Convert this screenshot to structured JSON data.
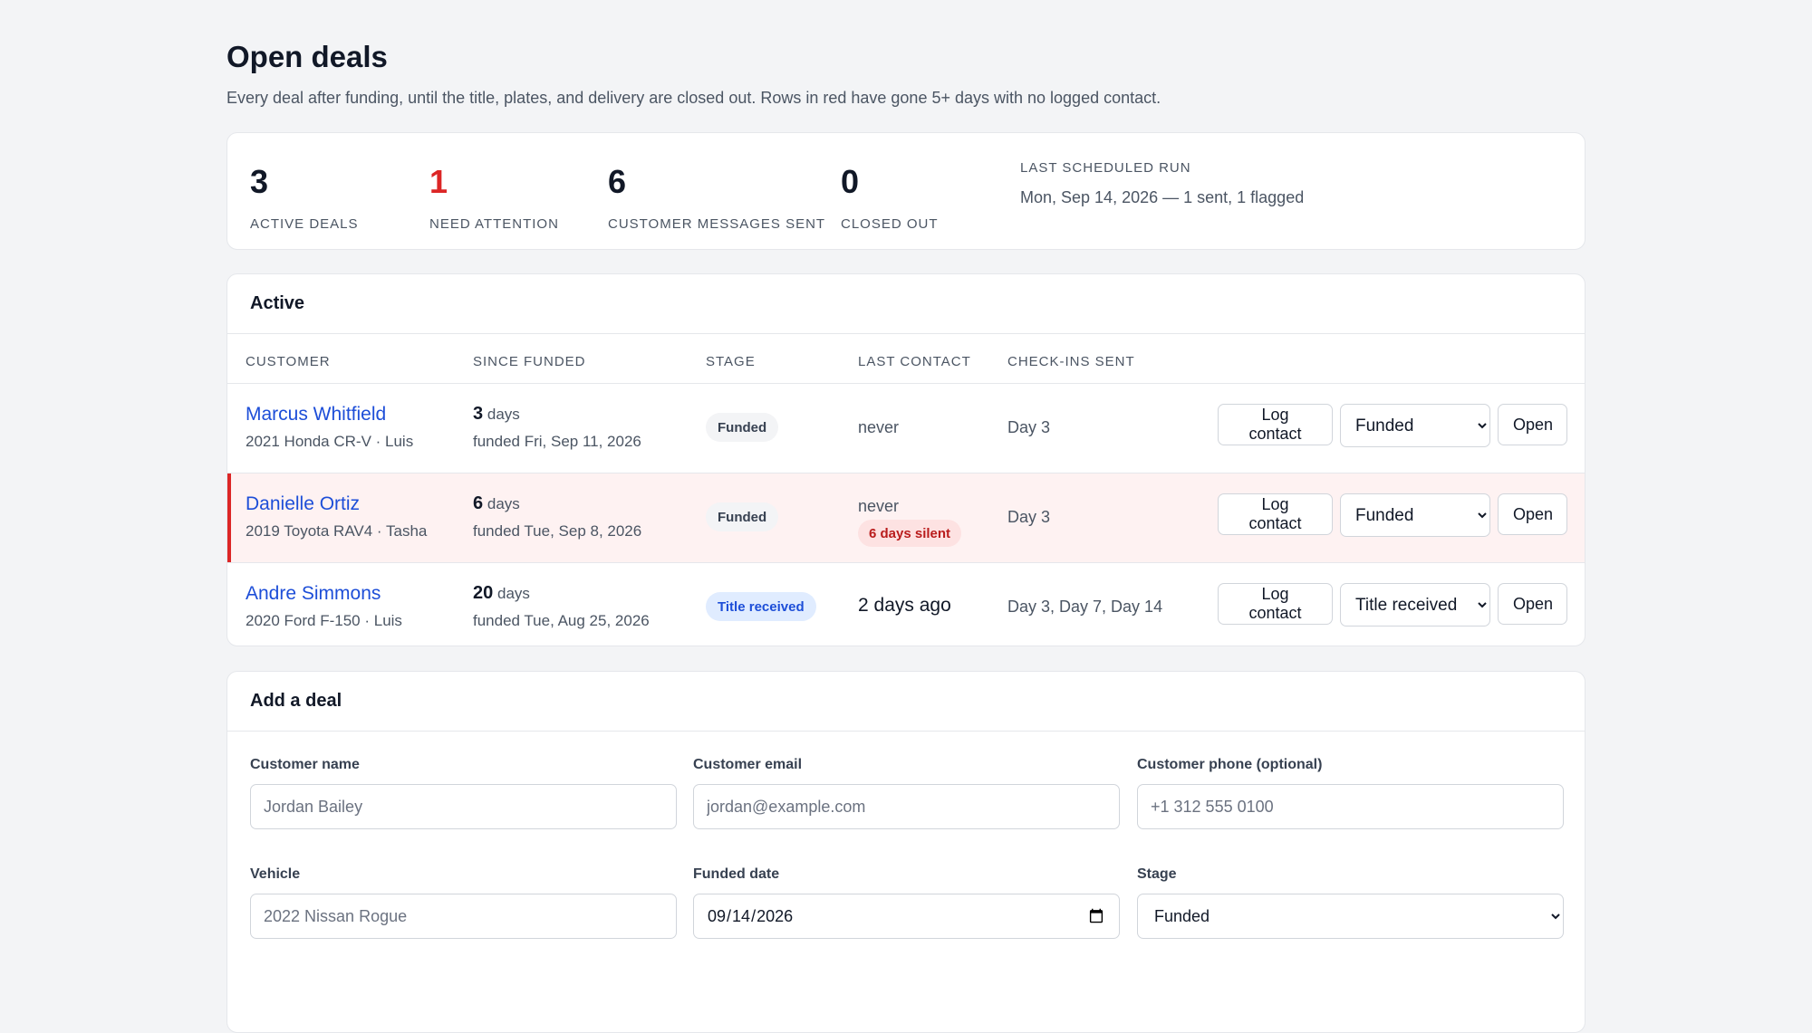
{
  "header": {
    "title": "Open deals",
    "subtitle": "Every deal after funding, until the title, plates, and delivery are closed out. Rows in red have gone 5+ days with no logged contact."
  },
  "stats": [
    {
      "value": "3",
      "label": "ACTIVE DEALS"
    },
    {
      "value": "1",
      "label": "NEED ATTENTION"
    },
    {
      "value": "6",
      "label": "CUSTOMER MESSAGES SENT"
    },
    {
      "value": "0",
      "label": "CLOSED OUT"
    }
  ],
  "last_run": {
    "label": "LAST SCHEDULED RUN",
    "value": "Mon, Sep 14, 2026 — 1 sent, 1 flagged"
  },
  "active": {
    "title": "Active",
    "columns": [
      "CUSTOMER",
      "SINCE FUNDED",
      "STAGE",
      "LAST CONTACT",
      "CHECK-INS SENT"
    ],
    "rows": [
      {
        "name": "Marcus Whitfield",
        "sub": "2021 Honda CR-V · Luis",
        "days": "3",
        "days_unit": "days",
        "funded": "funded Fri, Sep 11, 2026",
        "stage": "Funded",
        "last_contact": "never",
        "silent": "",
        "checkins": "Day 3",
        "log_label": "Log contact",
        "select_value": "Funded",
        "open_label": "Open"
      },
      {
        "name": "Danielle Ortiz",
        "sub": "2019 Toyota RAV4 · Tasha",
        "days": "6",
        "days_unit": "days",
        "funded": "funded Tue, Sep 8, 2026",
        "stage": "Funded",
        "last_contact": "never",
        "silent": "6 days silent",
        "checkins": "Day 3",
        "log_label": "Log contact",
        "select_value": "Funded",
        "open_label": "Open"
      },
      {
        "name": "Andre Simmons",
        "sub": "2020 Ford F-150 · Luis",
        "days": "20",
        "days_unit": "days",
        "funded": "funded Tue, Aug 25, 2026",
        "stage": "Title received",
        "last_contact": "2 days ago",
        "silent": "",
        "checkins": "Day 3, Day 7, Day 14",
        "log_label": "Log contact",
        "select_value": "Title received",
        "open_label": "Open"
      }
    ]
  },
  "add_deal": {
    "title": "Add a deal",
    "fields": {
      "name": {
        "label": "Customer name",
        "placeholder": "Jordan Bailey"
      },
      "email": {
        "label": "Customer email",
        "placeholder": "jordan@example.com"
      },
      "phone": {
        "label": "Customer phone (optional)",
        "placeholder": "+1 312 555 0100"
      },
      "vehicle": {
        "label": "Vehicle",
        "placeholder": "2022 Nissan Rogue"
      },
      "funded_date": {
        "label": "Funded date",
        "value": "2026-09-14"
      },
      "stage": {
        "label": "Stage",
        "value": "Funded"
      }
    }
  },
  "colors": {
    "accent": "#1d4ed8",
    "alert": "#dc2626",
    "alert_bg": "#fef2f2",
    "badge_blue": "#e0ecff"
  }
}
